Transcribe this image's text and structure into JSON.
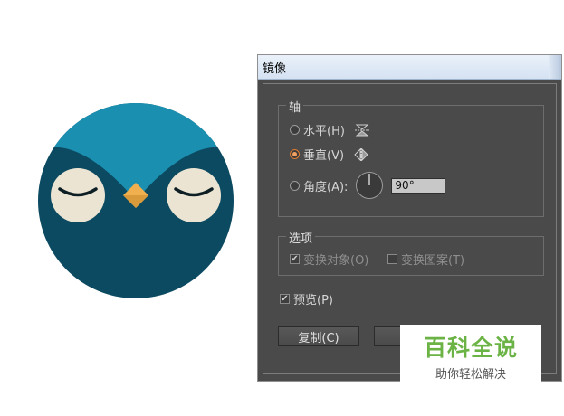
{
  "colors": {
    "owl_head": "#0b4a60",
    "owl_crest": "#1b8fb0",
    "owl_eye": "#ece4d2",
    "owl_beak": "#f0b050",
    "dialog_bg": "#4a4a4a",
    "accent_radio": "#e07a2e",
    "watermark_green": "#6bb345"
  },
  "dialog": {
    "title": "镜像",
    "axis_group": {
      "label": "轴",
      "horizontal": {
        "label": "水平(H)",
        "icon": "mirror-horizontal-icon",
        "selected": false
      },
      "vertical": {
        "label": "垂直(V)",
        "icon": "mirror-vertical-icon",
        "selected": true
      },
      "angle": {
        "label": "角度(A):",
        "icon": "angle-dial-icon",
        "value": "90°",
        "selected": false
      }
    },
    "options_group": {
      "label": "选项",
      "transform_objects": {
        "label": "变换对象(O)",
        "checked": true,
        "enabled": false
      },
      "transform_patterns": {
        "label": "变换图案(T)",
        "checked": false,
        "enabled": false
      }
    },
    "preview": {
      "label": "预览(P)",
      "checked": true
    },
    "buttons": {
      "copy": "复制(C)"
    }
  },
  "watermark": {
    "main": "百科全说",
    "sub": "助你轻松解决"
  }
}
